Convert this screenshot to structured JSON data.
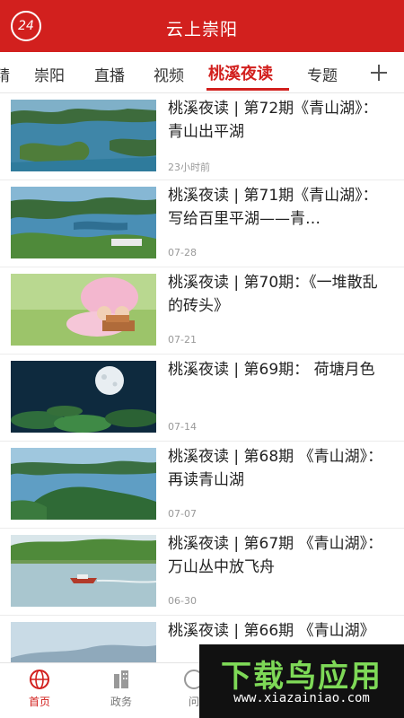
{
  "header": {
    "title": "云上崇阳",
    "badge_text": "24"
  },
  "tabs": {
    "items": [
      "精",
      "崇阳",
      "直播",
      "视频",
      "桃溪夜读",
      "专题"
    ],
    "active_index": 4
  },
  "articles": [
    {
      "title": "桃溪夜读 | 第72期《青山湖》：青山出平湖",
      "time": "23小时前"
    },
    {
      "title": "桃溪夜读 | 第71期《青山湖》：写给百里平湖——青…",
      "time": "07-28"
    },
    {
      "title": "桃溪夜读 | 第70期：《一堆散乱的砖头》",
      "time": "07-21"
    },
    {
      "title": "桃溪夜读 | 第69期： 荷塘月色",
      "time": "07-14"
    },
    {
      "title": "桃溪夜读 | 第68期 《青山湖》：再读青山湖",
      "time": "07-07"
    },
    {
      "title": "桃溪夜读 | 第67期 《青山湖》：万山丛中放飞舟",
      "time": "06-30"
    },
    {
      "title": "桃溪夜读 | 第66期 《青山湖》",
      "time": ""
    }
  ],
  "bottom_nav": [
    {
      "label": "首页",
      "icon": "globe-icon",
      "active": true
    },
    {
      "label": "政务",
      "icon": "building-icon",
      "active": false
    },
    {
      "label": "问",
      "icon": "question-icon",
      "active": false
    }
  ],
  "watermark": {
    "brand": "下载鸟应用",
    "site": "www.xiazainiao.com"
  },
  "colors": {
    "accent": "#d2201e"
  }
}
